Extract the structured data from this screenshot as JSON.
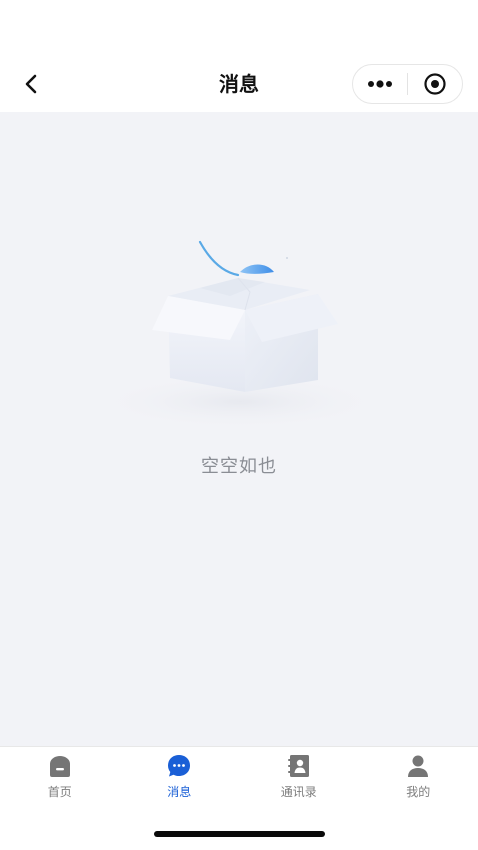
{
  "nav": {
    "title": "消息",
    "back_icon": "chevron-left-icon",
    "capsule": {
      "more_icon": "more-dots-icon",
      "close_icon": "target-circle-icon"
    }
  },
  "empty_state": {
    "illustration": "empty-box-icon",
    "text": "空空如也"
  },
  "tabbar": {
    "active_color": "#1a5fd6",
    "inactive_color": "#7d7d7d",
    "items": [
      {
        "label": "首页",
        "icon": "home-icon",
        "active": false
      },
      {
        "label": "消息",
        "icon": "message-bubble-icon",
        "active": true
      },
      {
        "label": "通讯录",
        "icon": "contacts-book-icon",
        "active": false
      },
      {
        "label": "我的",
        "icon": "user-icon",
        "active": false
      }
    ]
  }
}
